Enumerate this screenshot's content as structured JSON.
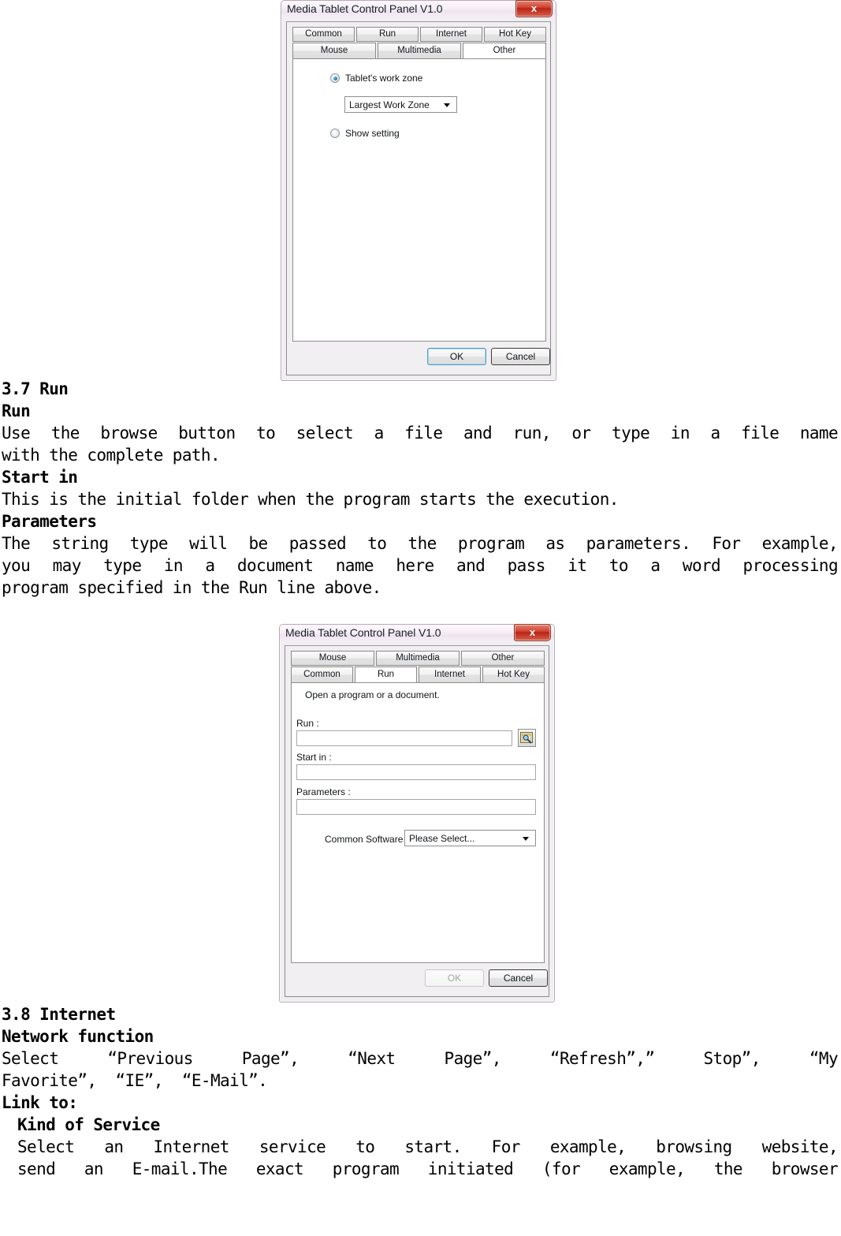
{
  "dialog_other": {
    "title": "Media Tablet Control Panel V1.0",
    "close_label": "x",
    "tabs_row1": [
      {
        "label": "Common",
        "active": false
      },
      {
        "label": "Run",
        "active": false
      },
      {
        "label": "Internet",
        "active": false
      },
      {
        "label": "Hot Key",
        "active": false
      }
    ],
    "tabs_row2": [
      {
        "label": "Mouse",
        "active": false
      },
      {
        "label": "Multimedia",
        "active": false
      },
      {
        "label": "Other",
        "active": true
      }
    ],
    "radio_work_zone": "Tablet's work zone",
    "radio_show_setting": "Show setting",
    "work_zone_value": "Largest Work Zone",
    "ok_label": "OK",
    "cancel_label": "Cancel"
  },
  "dialog_run": {
    "title": "Media Tablet Control Panel V1.0",
    "close_label": "x",
    "tabs_row1": [
      {
        "label": "Mouse",
        "active": false
      },
      {
        "label": "Multimedia",
        "active": false
      },
      {
        "label": "Other",
        "active": false
      }
    ],
    "tabs_row2": [
      {
        "label": "Common",
        "active": false
      },
      {
        "label": "Run",
        "active": true
      },
      {
        "label": "Internet",
        "active": false
      },
      {
        "label": "Hot Key",
        "active": false
      }
    ],
    "heading": "Open a program or a document.",
    "run_label": "Run :",
    "run_value": "",
    "start_in_label": "Start in :",
    "start_in_value": "",
    "parameters_label": "Parameters :",
    "parameters_value": "",
    "common_software_label": "Common Software :",
    "common_software_value": "Please Select...",
    "browse_icon": "folder-search-icon",
    "ok_label": "OK",
    "cancel_label": "Cancel"
  },
  "doc": {
    "section_run_number": "3.7 Run",
    "run_heading": "Run",
    "run_body_line1": "Use the browse button to select a file and run, or type in a file name",
    "run_body_line2": "with the complete path.",
    "start_in_heading": "Start in",
    "start_in_body": "This is the initial folder when the program starts the execution.",
    "parameters_heading": "Parameters",
    "parameters_body_line1": "The string type will be passed to the program as parameters. For example,",
    "parameters_body_line2": "you may type in a document name here and pass it to a word processing",
    "parameters_body_line3": "program specified in the Run line above.",
    "section_internet_number": "3.8 Internet",
    "network_heading": "Network function",
    "network_body_line1": "Select  “Previous Page”,  “Next Page”,  “Refresh”,” Stop”,  “My",
    "network_body_line2": "Favorite”,  “IE”,  “E-Mail”.",
    "link_to_heading": "Link to:",
    "kind_of_service_heading": "Kind of Service",
    "kind_body_line1": "Select an Internet service to start. For example, browsing website,",
    "kind_body_line2": "send an E-mail.The exact program initiated (for example, the browser"
  }
}
